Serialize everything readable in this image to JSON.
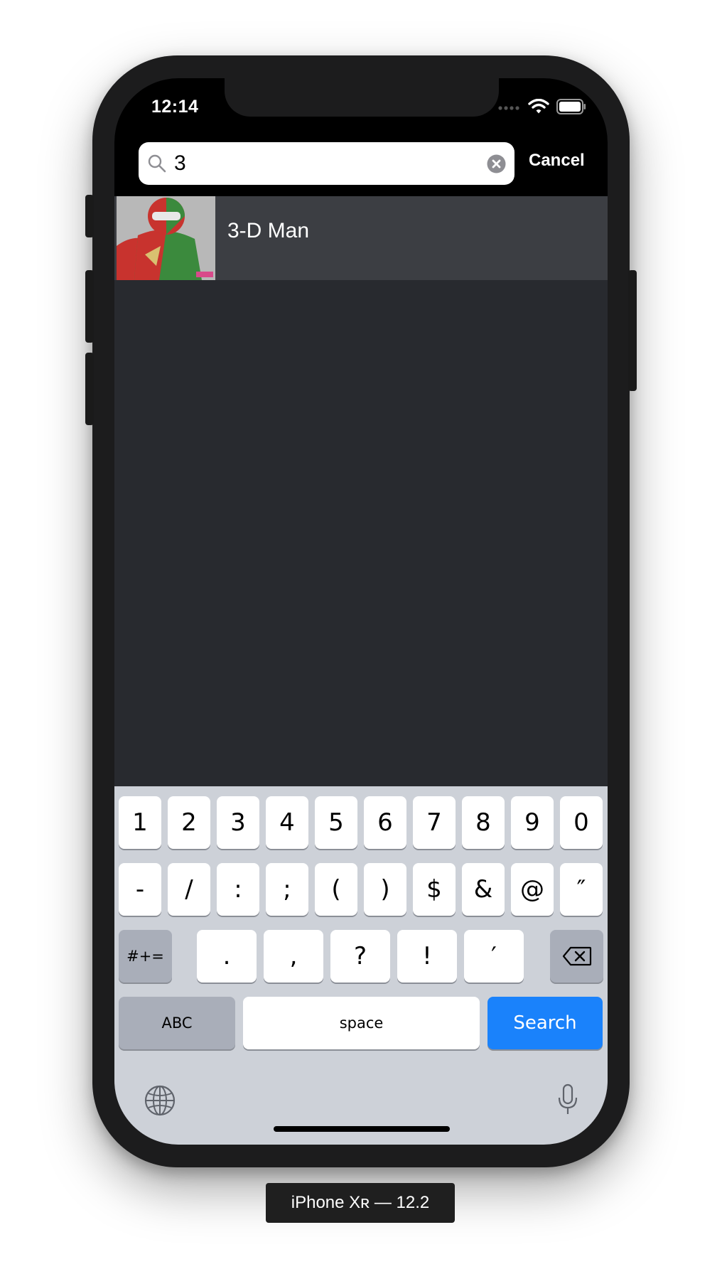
{
  "status_bar": {
    "time": "12:14"
  },
  "search": {
    "query": "3",
    "cancel_label": "Cancel"
  },
  "results": [
    {
      "name": "3-D Man"
    }
  ],
  "keyboard": {
    "row1": [
      "1",
      "2",
      "3",
      "4",
      "5",
      "6",
      "7",
      "8",
      "9",
      "0"
    ],
    "row2": [
      "-",
      "/",
      ":",
      ";",
      "(",
      ")",
      "$",
      "&",
      "@",
      "″"
    ],
    "row3": [
      "#+=",
      ".",
      ",",
      "?",
      "!",
      "′"
    ],
    "abc": "ABC",
    "space": "space",
    "search": "Search"
  },
  "device_label": "iPhone Xʀ — 12.2",
  "colors": {
    "accent": "#1a82fb",
    "screen_bg": "#282a2f",
    "row_bg": "#3c3e43",
    "keyboard_bg": "#cdd1d8"
  },
  "icons": [
    "search-icon",
    "clear-icon",
    "wifi-icon",
    "battery-icon",
    "signal-icon",
    "delete-icon",
    "globe-icon",
    "microphone-icon"
  ]
}
